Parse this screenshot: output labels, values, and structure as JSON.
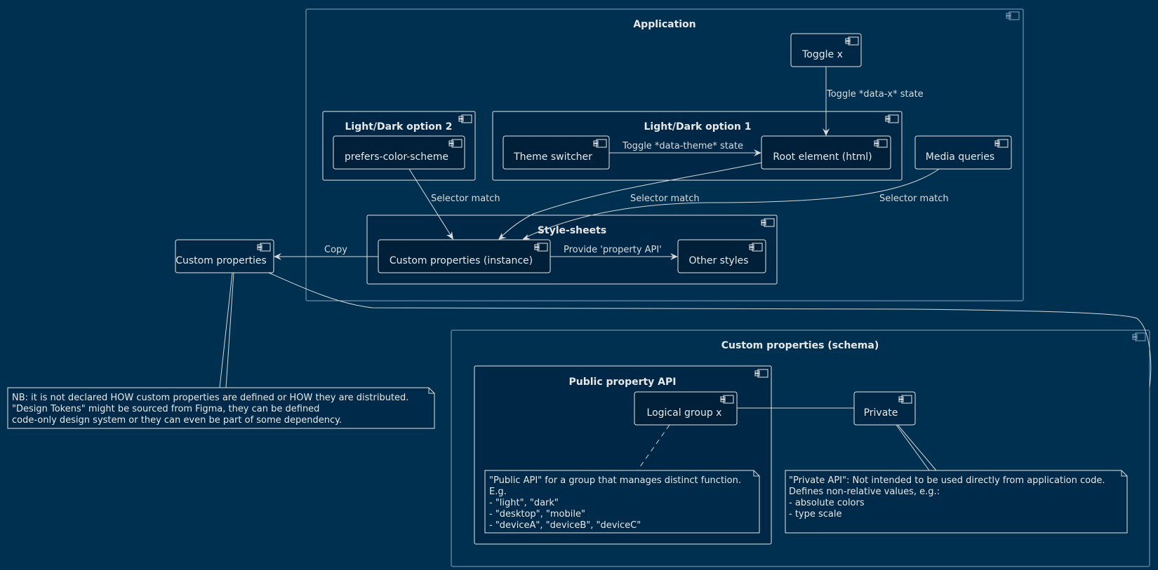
{
  "diagram": {
    "packages": {
      "application": "Application",
      "option2": "Light/Dark option 2",
      "option1": "Light/Dark option 1",
      "stylesheets": "Style-sheets",
      "schema": "Custom properties (schema)",
      "public_api": "Public property API"
    },
    "components": {
      "toggle_x": "Toggle x",
      "prefers_color_scheme": "prefers-color-scheme",
      "theme_switcher": "Theme switcher",
      "root_element": "Root element (html)",
      "media_queries": "Media queries",
      "custom_properties": "Custom properties",
      "custom_properties_instance": "Custom properties (instance)",
      "other_styles": "Other styles",
      "logical_group_x": "Logical group x",
      "private": "Private"
    },
    "edges": {
      "toggle_x_to_root": "Toggle *data-x* state",
      "theme_to_root": "Toggle *data-theme* state",
      "prefers_to_instance": "Selector match",
      "root_to_instance": "Selector match",
      "media_to_instance": "Selector match",
      "instance_to_custom": "Copy",
      "instance_to_other": "Provide 'property API'"
    },
    "notes": {
      "custom_properties_note": [
        "NB: it is not declared HOW custom properties are defined or HOW they are distributed.",
        "\"Design Tokens\" might be sourced from Figma, they can be defined",
        "code-only design system or they can even be part of some dependency."
      ],
      "public_api_note": [
        "\"Public API\" for a group that manages distinct function.",
        "E.g.",
        "- \"light\", \"dark\"",
        "- \"desktop\", \"mobile\"",
        "- \"deviceA\", \"deviceB\", \"deviceC\""
      ],
      "private_note": [
        "\"Private API\": Not intended to be used directly from application code.",
        "Defines non-relative values, e.g.:",
        "- absolute colors",
        "- type scale"
      ]
    },
    "colors": {
      "background": "#003050",
      "package_border": "#8aa4bb",
      "line": "#e6e6e6"
    }
  }
}
